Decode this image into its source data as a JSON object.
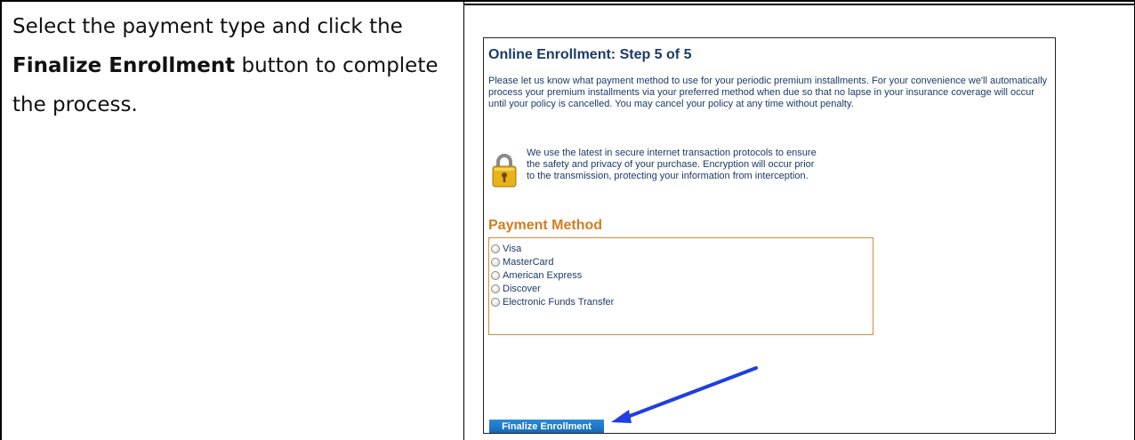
{
  "instruction": {
    "line1": "Select the payment type and click the",
    "bold": "Finalize Enrollment",
    "line2_rest": " button to complete",
    "line3": "the process."
  },
  "screenshot": {
    "title": "Online Enrollment: Step 5 of 5",
    "intro": "Please let us know what payment method to use for your periodic premium installments.  For your convenience we'll automatically process your premium installments via your preferred method when due so that no lapse in your insurance coverage will occur until your policy is cancelled.  You may cancel your policy at any time without penalty.",
    "secure_text": "We use the latest in secure internet transaction protocols to ensure the safety and privacy of your purchase.  Encryption will occur prior to the transmission, protecting your information from interception.",
    "lock_icon": "padlock-icon",
    "payment_method_title": "Payment Method",
    "options": [
      "Visa",
      "MasterCard",
      "American Express",
      "Discover",
      "Electronic Funds Transfer"
    ],
    "finalize_label": "Finalize Enrollment",
    "colors": {
      "title": "#1c3a66",
      "section": "#d07d20",
      "button": "#1a78c8",
      "arrow": "#1f3fe0"
    }
  }
}
